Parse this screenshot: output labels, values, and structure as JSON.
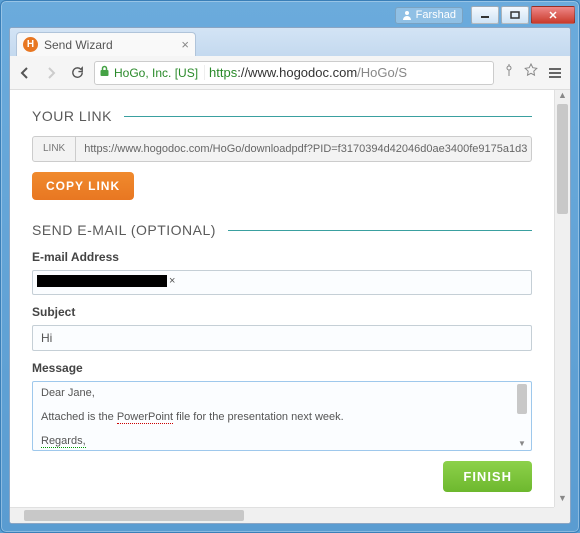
{
  "window": {
    "user": "Farshad"
  },
  "tab": {
    "title": "Send Wizard",
    "favicon_letter": "H"
  },
  "omnibox": {
    "ev_identity": "HoGo, Inc. [US]",
    "scheme": "https",
    "host": "://www.hogodoc.com",
    "path": "/HoGo/S"
  },
  "page": {
    "your_link_title": "YOUR LINK",
    "link_label": "LINK",
    "link_value": "https://www.hogodoc.com/HoGo/downloadpdf?PID=f3170394d42046d0ae3400fe9175a1d3",
    "copy_link_label": "COPY LINK",
    "send_email_title": "SEND E-MAIL (OPTIONAL)",
    "email_label": "E-mail Address",
    "email_chip_remove": "×",
    "subject_label": "Subject",
    "subject_value": "Hi",
    "message_label": "Message",
    "message_line1": "Dear Jane,",
    "message_line2_a": "Attached is the ",
    "message_line2_b": "PowerPoint",
    "message_line2_c": " file for the presentation next week.",
    "message_line3": "Regards,",
    "finish_label": "FINISH"
  }
}
